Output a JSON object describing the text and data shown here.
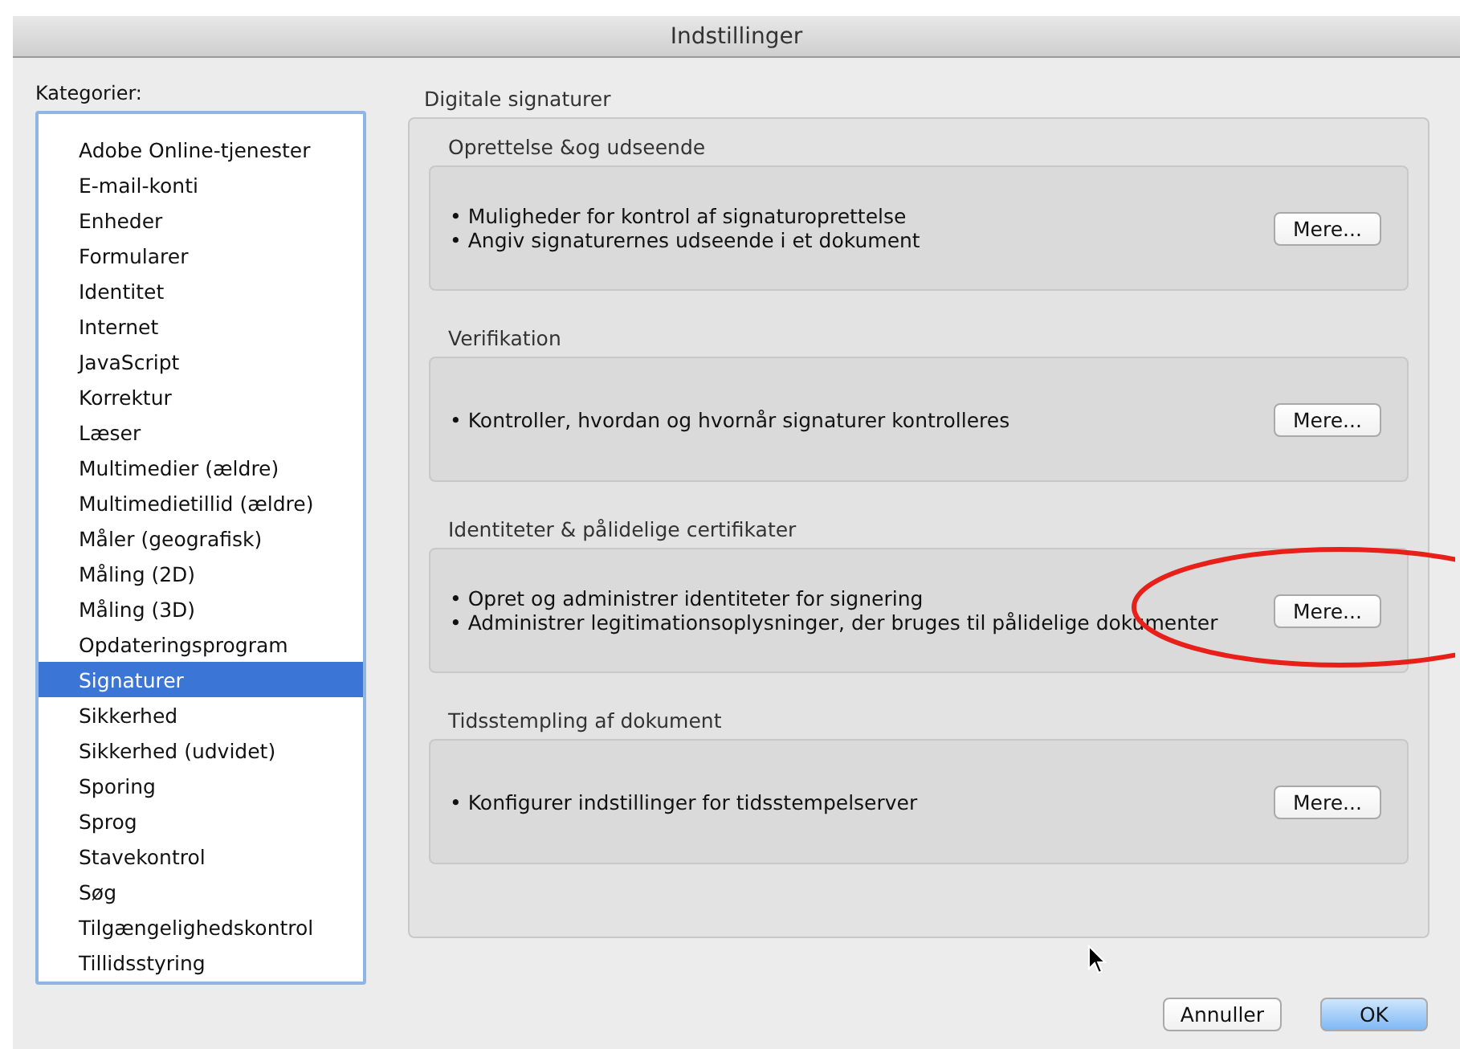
{
  "window": {
    "title": "Indstillinger"
  },
  "categories": {
    "label": "Kategorier:",
    "items": [
      {
        "label": "Adobe Online-tjenester",
        "selected": false
      },
      {
        "label": "E-mail-konti",
        "selected": false
      },
      {
        "label": "Enheder",
        "selected": false
      },
      {
        "label": "Formularer",
        "selected": false
      },
      {
        "label": "Identitet",
        "selected": false
      },
      {
        "label": "Internet",
        "selected": false
      },
      {
        "label": "JavaScript",
        "selected": false
      },
      {
        "label": "Korrektur",
        "selected": false
      },
      {
        "label": "Læser",
        "selected": false
      },
      {
        "label": "Multimedier (ældre)",
        "selected": false
      },
      {
        "label": "Multimedietillid (ældre)",
        "selected": false
      },
      {
        "label": "Måler (geografisk)",
        "selected": false
      },
      {
        "label": "Måling (2D)",
        "selected": false
      },
      {
        "label": "Måling (3D)",
        "selected": false
      },
      {
        "label": "Opdateringsprogram",
        "selected": false
      },
      {
        "label": "Signaturer",
        "selected": true
      },
      {
        "label": "Sikkerhed",
        "selected": false
      },
      {
        "label": "Sikkerhed (udvidet)",
        "selected": false
      },
      {
        "label": "Sporing",
        "selected": false
      },
      {
        "label": "Sprog",
        "selected": false
      },
      {
        "label": "Stavekontrol",
        "selected": false
      },
      {
        "label": "Søg",
        "selected": false
      },
      {
        "label": "Tilgængelighedskontrol",
        "selected": false
      },
      {
        "label": "Tillidsstyring",
        "selected": false
      }
    ]
  },
  "panel": {
    "title": "Digitale signaturer",
    "sections": [
      {
        "title": "Oprettelse &og udseende",
        "bullets": [
          "• Muligheder for kontrol af signaturoprettelse",
          "• Angiv signaturernes udseende i et dokument"
        ],
        "button": "Mere...",
        "highlighted": false
      },
      {
        "title": "Verifikation",
        "bullets": [
          "• Kontroller, hvordan og hvornår signaturer kontrolleres"
        ],
        "button": "Mere...",
        "highlighted": false
      },
      {
        "title": "Identiteter & pålidelige certifikater",
        "bullets": [
          "• Opret og administrer identiteter for signering",
          "• Administrer legitimationsoplysninger, der bruges til pålidelige dokumenter"
        ],
        "button": "Mere...",
        "highlighted": true
      },
      {
        "title": "Tidsstempling af dokument",
        "bullets": [
          "• Konfigurer indstillinger for tidsstempelserver"
        ],
        "button": "Mere...",
        "highlighted": false
      }
    ]
  },
  "buttons": [
    {
      "label": "Annuller",
      "kind": "cancel"
    },
    {
      "label": "OK",
      "kind": "default"
    }
  ]
}
